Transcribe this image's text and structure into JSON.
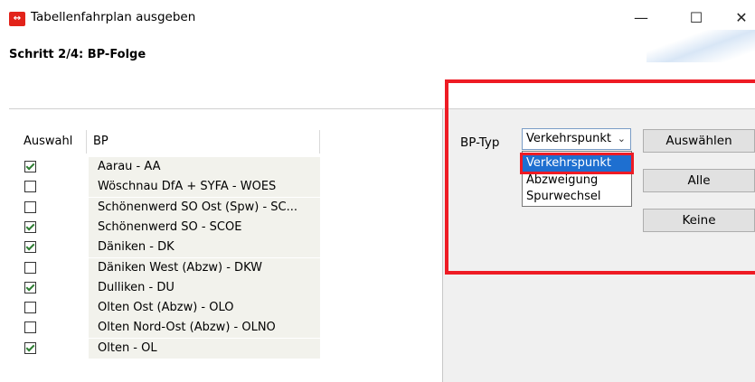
{
  "window": {
    "icon_text": "↔",
    "title": "Tabellenfahrplan ausgeben",
    "minimize_glyph": "—",
    "maximize_glyph": "☐",
    "close_glyph": "✕"
  },
  "step": {
    "title": "Schritt 2/4: BP-Folge"
  },
  "table": {
    "columns": [
      "Auswahl",
      "BP"
    ],
    "rows": [
      {
        "checked": true,
        "bp": "Aarau - AA"
      },
      {
        "checked": false,
        "bp": "Wöschnau DfA + SYFA - WOES"
      },
      {
        "checked": false,
        "bp": "Schönenwerd SO Ost (Spw) - SC..."
      },
      {
        "checked": true,
        "bp": "Schönenwerd SO - SCOE"
      },
      {
        "checked": true,
        "bp": "Däniken - DK"
      },
      {
        "checked": false,
        "bp": "Däniken West (Abzw) - DKW"
      },
      {
        "checked": true,
        "bp": "Dulliken - DU"
      },
      {
        "checked": false,
        "bp": "Olten Ost (Abzw) - OLO"
      },
      {
        "checked": false,
        "bp": "Olten Nord-Ost (Abzw) - OLNO"
      },
      {
        "checked": true,
        "bp": "Olten - OL"
      }
    ]
  },
  "filter": {
    "label": "BP-Typ",
    "selected_value": "Verkehrspunkt",
    "options": [
      "Verkehrspunkt",
      "Abzweigung",
      "Spurwechsel"
    ],
    "highlighted_option_index": 0
  },
  "buttons": {
    "select_label": "Auswählen",
    "all_label": "Alle",
    "none_label": "Keine"
  },
  "colors": {
    "accent_red": "#ee1b24",
    "selection_blue": "#1e6fd0",
    "app_icon_red": "#e2231a"
  }
}
